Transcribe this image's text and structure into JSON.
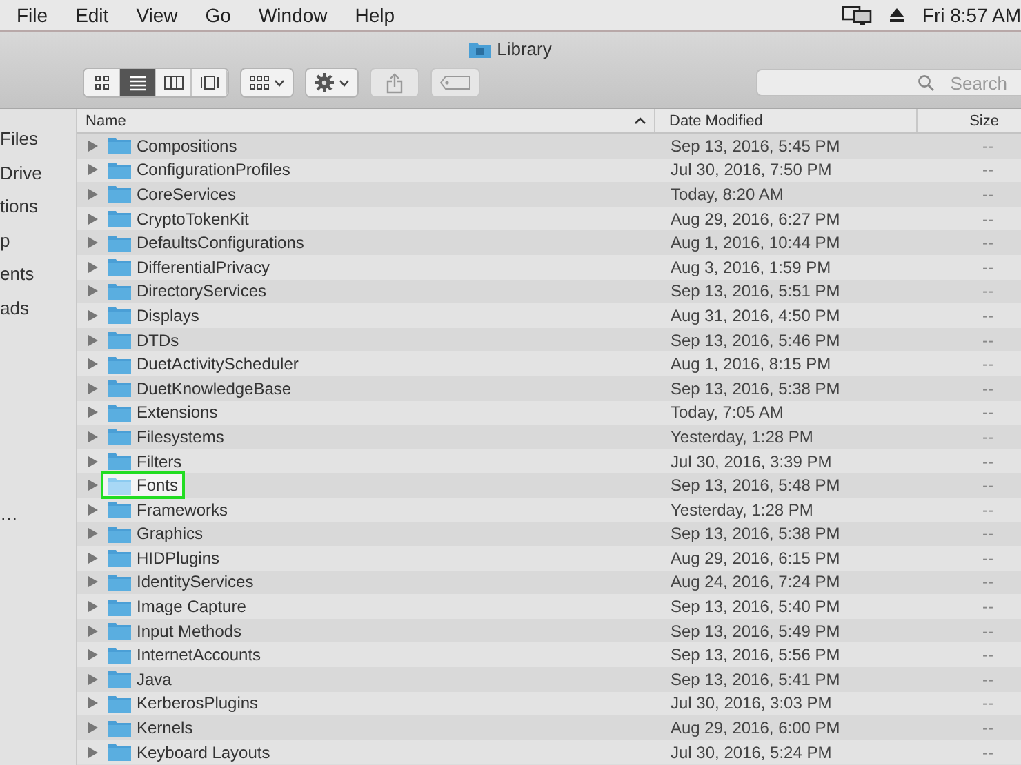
{
  "menu_bar": {
    "menus": [
      "File",
      "Edit",
      "View",
      "Go",
      "Window",
      "Help"
    ],
    "clock": "Fri 8:57 AM"
  },
  "window": {
    "title": "Library"
  },
  "toolbar": {
    "view_modes": [
      {
        "kind": "icons",
        "selected": false
      },
      {
        "kind": "list",
        "selected": true
      },
      {
        "kind": "columns",
        "selected": false
      },
      {
        "kind": "coverflow",
        "selected": false
      }
    ],
    "share_disabled": true,
    "tags_disabled": true,
    "search": {
      "placeholder": "Search"
    }
  },
  "sidebar": {
    "items": [
      "Files",
      "Drive",
      "tions",
      "p",
      "ents",
      "ads",
      "…"
    ]
  },
  "table": {
    "columns": [
      "Name",
      "Date Modified",
      "Size"
    ],
    "rows": [
      {
        "name": "Compositions",
        "date": "Sep 13, 2016, 5:45 PM",
        "size": "--",
        "highlighted": false
      },
      {
        "name": "ConfigurationProfiles",
        "date": "Jul 30, 2016, 7:50 PM",
        "size": "--",
        "highlighted": false
      },
      {
        "name": "CoreServices",
        "date": "Today, 8:20 AM",
        "size": "--",
        "highlighted": false
      },
      {
        "name": "CryptoTokenKit",
        "date": "Aug 29, 2016, 6:27 PM",
        "size": "--",
        "highlighted": false
      },
      {
        "name": "DefaultsConfigurations",
        "date": "Aug 1, 2016, 10:44 PM",
        "size": "--",
        "highlighted": false
      },
      {
        "name": "DifferentialPrivacy",
        "date": "Aug 3, 2016, 1:59 PM",
        "size": "--",
        "highlighted": false
      },
      {
        "name": "DirectoryServices",
        "date": "Sep 13, 2016, 5:51 PM",
        "size": "--",
        "highlighted": false
      },
      {
        "name": "Displays",
        "date": "Aug 31, 2016, 4:50 PM",
        "size": "--",
        "highlighted": false
      },
      {
        "name": "DTDs",
        "date": "Sep 13, 2016, 5:46 PM",
        "size": "--",
        "highlighted": false
      },
      {
        "name": "DuetActivityScheduler",
        "date": "Aug 1, 2016, 8:15 PM",
        "size": "--",
        "highlighted": false
      },
      {
        "name": "DuetKnowledgeBase",
        "date": "Sep 13, 2016, 5:38 PM",
        "size": "--",
        "highlighted": false
      },
      {
        "name": "Extensions",
        "date": "Today, 7:05 AM",
        "size": "--",
        "highlighted": false
      },
      {
        "name": "Filesystems",
        "date": "Yesterday, 1:28 PM",
        "size": "--",
        "highlighted": false
      },
      {
        "name": "Filters",
        "date": "Jul 30, 2016, 3:39 PM",
        "size": "--",
        "highlighted": false
      },
      {
        "name": "Fonts",
        "date": "Sep 13, 2016, 5:48 PM",
        "size": "--",
        "highlighted": true
      },
      {
        "name": "Frameworks",
        "date": "Yesterday, 1:28 PM",
        "size": "--",
        "highlighted": false
      },
      {
        "name": "Graphics",
        "date": "Sep 13, 2016, 5:38 PM",
        "size": "--",
        "highlighted": false
      },
      {
        "name": "HIDPlugins",
        "date": "Aug 29, 2016, 6:15 PM",
        "size": "--",
        "highlighted": false
      },
      {
        "name": "IdentityServices",
        "date": "Aug 24, 2016, 7:24 PM",
        "size": "--",
        "highlighted": false
      },
      {
        "name": "Image Capture",
        "date": "Sep 13, 2016, 5:40 PM",
        "size": "--",
        "highlighted": false
      },
      {
        "name": "Input Methods",
        "date": "Sep 13, 2016, 5:49 PM",
        "size": "--",
        "highlighted": false
      },
      {
        "name": "InternetAccounts",
        "date": "Sep 13, 2016, 5:56 PM",
        "size": "--",
        "highlighted": false
      },
      {
        "name": "Java",
        "date": "Sep 13, 2016, 5:41 PM",
        "size": "--",
        "highlighted": false
      },
      {
        "name": "KerberosPlugins",
        "date": "Jul 30, 2016, 3:03 PM",
        "size": "--",
        "highlighted": false
      },
      {
        "name": "Kernels",
        "date": "Aug 29, 2016, 6:00 PM",
        "size": "--",
        "highlighted": false
      },
      {
        "name": "Keyboard Layouts",
        "date": "Jul 30, 2016, 5:24 PM",
        "size": "--",
        "highlighted": false
      }
    ]
  }
}
